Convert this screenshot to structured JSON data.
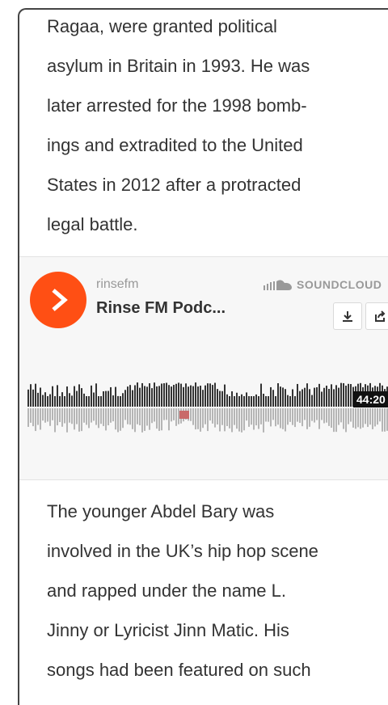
{
  "article": {
    "paragraph_1": "Ragaa, were granted political asylum in Britain in 1993. He was later arrested for the 1998 bombings and extradited to the United States in 2012 after a protracted legal battle.",
    "paragraph_1_lines": [
      "Ragaa, were granted political",
      "asylum in Britain in 1993. He was",
      "later arrested for the 1998 bomb-",
      "ings and extradited to the United",
      "States in 2012 after a protracted",
      "legal battle."
    ],
    "paragraph_2_lines": [
      "The younger Abdel Bary was",
      "involved in the UK’s hip hop scene",
      "and rapped under the name L.",
      "Jinny or Lyricist Jinn Matic. His",
      "songs had been featured on such"
    ]
  },
  "player": {
    "user": "rinsefm",
    "track_title": "Rinse FM Podc...",
    "brand": "SOUNDCLOUD",
    "duration": "44:20",
    "play_icon": "play-icon",
    "download_icon": "download-icon",
    "share_icon": "share-icon",
    "accent_color": "#ff4f14"
  }
}
